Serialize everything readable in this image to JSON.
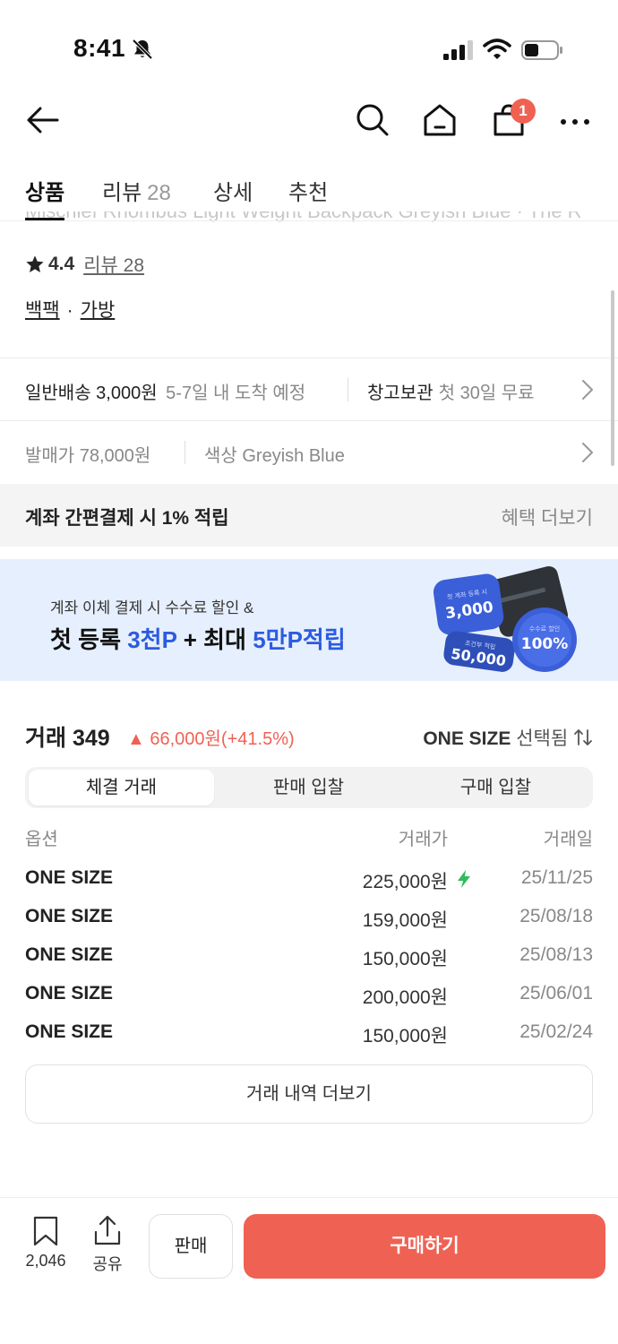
{
  "status_bar": {
    "time": "8:41"
  },
  "nav": {
    "cart_badge": "1"
  },
  "tabs": [
    {
      "label": "상품",
      "count": ""
    },
    {
      "label": "리뷰",
      "count": "28"
    },
    {
      "label": "상세",
      "count": ""
    },
    {
      "label": "추천",
      "count": ""
    }
  ],
  "product": {
    "title_partial": "Mischief Rhombus Light Weight Backpack Greyish Blue · The R",
    "rating": "4.4",
    "review_link": "리뷰 28",
    "category_1": "백팩",
    "category_sep": "·",
    "category_2": "가방"
  },
  "shipping": {
    "label": "일반배송 3,000원",
    "eta": "5-7일 내 도착 예정",
    "storage_label": "창고보관",
    "storage_note": "첫 30일 무료"
  },
  "option_info": {
    "release_price": "발매가 78,000원",
    "color": "색상 Greyish Blue"
  },
  "benefit": {
    "text": "계좌 간편결제 시 1% 적립",
    "more": "혜택 더보기"
  },
  "banner": {
    "line1": "계좌 이체 결제 시 수수료 할인 &",
    "line2_a": "첫 등록 ",
    "line2_b": "3천P",
    "line2_c": " + 최대 ",
    "line2_d": "5만P적립",
    "badge1_small": "첫 계좌 등록 시",
    "badge1_value": "3,000",
    "badge2_small": "조건부 적립",
    "badge2_value": "50,000",
    "badge3_small": "수수료 할인",
    "badge3_value": "100%"
  },
  "trades": {
    "title": "거래 349",
    "change": "▲ 66,000원(+41.5%)",
    "size_label": "ONE SIZE",
    "size_suffix": "선택됨",
    "segments": [
      "체결 거래",
      "판매 입찰",
      "구매 입찰"
    ],
    "headers": {
      "option": "옵션",
      "price": "거래가",
      "date": "거래일"
    },
    "rows": [
      {
        "option": "ONE SIZE",
        "price": "225,000원",
        "date": "25/11/25",
        "fast": true
      },
      {
        "option": "ONE SIZE",
        "price": "159,000원",
        "date": "25/08/18",
        "fast": false
      },
      {
        "option": "ONE SIZE",
        "price": "150,000원",
        "date": "25/08/13",
        "fast": false
      },
      {
        "option": "ONE SIZE",
        "price": "200,000원",
        "date": "25/06/01",
        "fast": false
      },
      {
        "option": "ONE SIZE",
        "price": "150,000원",
        "date": "25/02/24",
        "fast": false
      }
    ],
    "more_button": "거래 내역 더보기"
  },
  "bottom_bar": {
    "bookmark_count": "2,046",
    "share_label": "공유",
    "sell_label": "판매",
    "buy_label": "구매하기"
  },
  "colors": {
    "accent": "#ef6253",
    "banner_bg": "#e6effd",
    "banner_blue": "#2c5be0"
  },
  "icons": [
    "bell-off-icon",
    "signal-icon",
    "wifi-icon",
    "battery-icon",
    "back-arrow-icon",
    "search-icon",
    "home-icon",
    "cart-icon",
    "more-icon",
    "star-icon",
    "chevron-right-icon",
    "sort-icon",
    "lightning-icon",
    "bookmark-icon",
    "share-icon"
  ]
}
